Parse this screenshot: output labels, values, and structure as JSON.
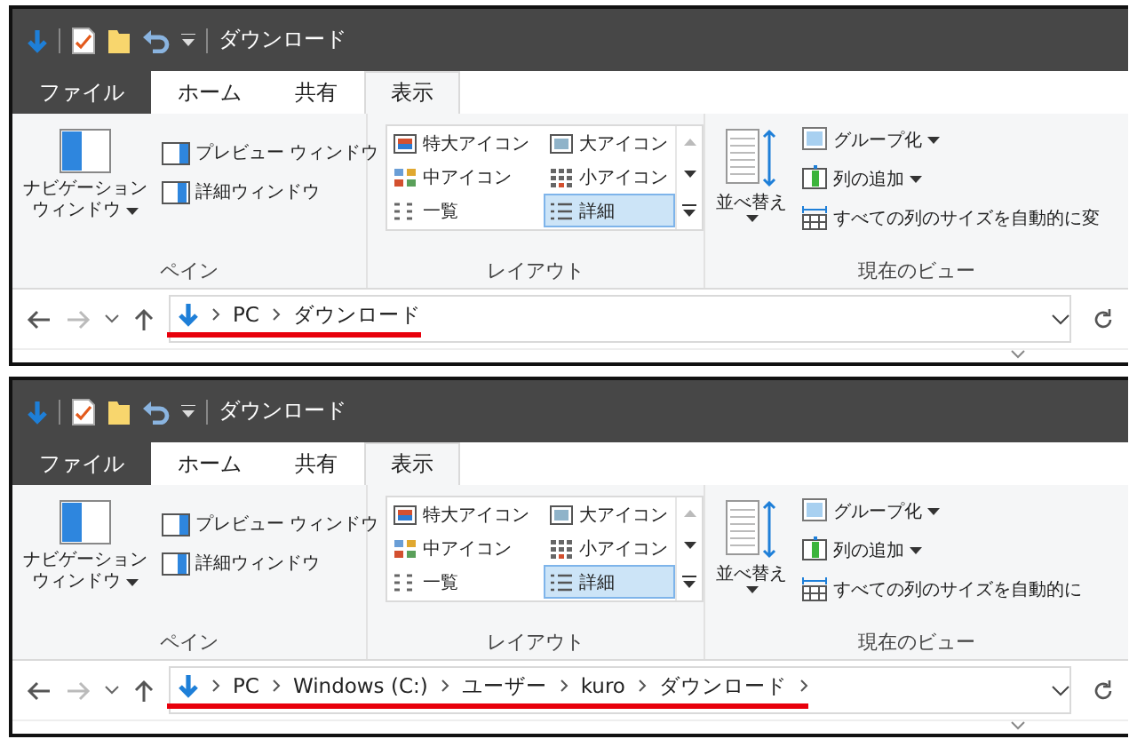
{
  "windows": [
    {
      "title": "ダウンロード",
      "tabs": [
        {
          "label": "ファイル",
          "kind": "file",
          "selected": false
        },
        {
          "label": "ホーム",
          "kind": "tab",
          "selected": false
        },
        {
          "label": "共有",
          "kind": "tab",
          "selected": false
        },
        {
          "label": "表示",
          "kind": "tab",
          "selected": true
        }
      ],
      "pane_group": {
        "label": "ペイン",
        "nav_button": [
          "ナビゲーション",
          "ウィンドウ"
        ],
        "items": [
          "プレビュー ウィンドウ",
          "詳細ウィンドウ"
        ]
      },
      "layout_group": {
        "label": "レイアウト",
        "items": [
          {
            "label": "特大アイコン",
            "kind": "xl",
            "selected": false
          },
          {
            "label": "大アイコン",
            "kind": "large",
            "selected": false
          },
          {
            "label": "中アイコン",
            "kind": "medium",
            "selected": false
          },
          {
            "label": "小アイコン",
            "kind": "small",
            "selected": false
          },
          {
            "label": "一覧",
            "kind": "list",
            "selected": false
          },
          {
            "label": "詳細",
            "kind": "details",
            "selected": true
          }
        ]
      },
      "view_group": {
        "label": "現在のビュー",
        "sort_button": "並べ替え",
        "items": [
          {
            "label": "グループ化",
            "kind": "group",
            "dropdown": true
          },
          {
            "label": "列の追加",
            "kind": "columns",
            "dropdown": true
          },
          {
            "label": "すべての列のサイズを自動的に変",
            "kind": "fit",
            "dropdown": false
          }
        ]
      },
      "address": {
        "path": [
          "PC",
          "ダウンロード"
        ],
        "trailing_chevron": false,
        "highlighted": true
      }
    },
    {
      "title": "ダウンロード",
      "tabs": [
        {
          "label": "ファイル",
          "kind": "file",
          "selected": false
        },
        {
          "label": "ホーム",
          "kind": "tab",
          "selected": false
        },
        {
          "label": "共有",
          "kind": "tab",
          "selected": false
        },
        {
          "label": "表示",
          "kind": "tab",
          "selected": true
        }
      ],
      "pane_group": {
        "label": "ペイン",
        "nav_button": [
          "ナビゲーション",
          "ウィンドウ"
        ],
        "items": [
          "プレビュー ウィンドウ",
          "詳細ウィンドウ"
        ]
      },
      "layout_group": {
        "label": "レイアウト",
        "items": [
          {
            "label": "特大アイコン",
            "kind": "xl",
            "selected": false
          },
          {
            "label": "大アイコン",
            "kind": "large",
            "selected": false
          },
          {
            "label": "中アイコン",
            "kind": "medium",
            "selected": false
          },
          {
            "label": "小アイコン",
            "kind": "small",
            "selected": false
          },
          {
            "label": "一覧",
            "kind": "list",
            "selected": false
          },
          {
            "label": "詳細",
            "kind": "details",
            "selected": true
          }
        ]
      },
      "view_group": {
        "label": "現在のビュー",
        "sort_button": "並べ替え",
        "items": [
          {
            "label": "グループ化",
            "kind": "group",
            "dropdown": true
          },
          {
            "label": "列の追加",
            "kind": "columns",
            "dropdown": true
          },
          {
            "label": "すべての列のサイズを自動的に",
            "kind": "fit",
            "dropdown": false
          }
        ]
      },
      "address": {
        "path": [
          "PC",
          "Windows (C:)",
          "ユーザー",
          "kuro",
          "ダウンロード"
        ],
        "trailing_chevron": true,
        "highlighted": true
      }
    }
  ]
}
